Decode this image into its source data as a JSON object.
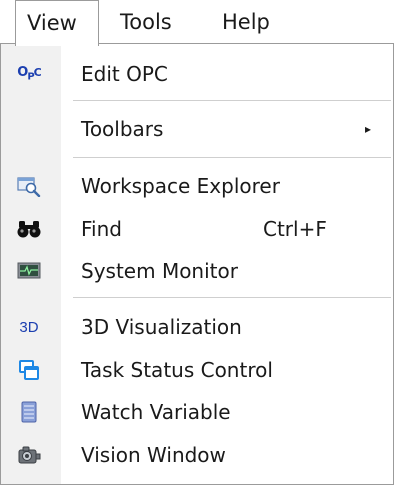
{
  "menubar": {
    "items": [
      {
        "label": "View"
      },
      {
        "label": "Tools"
      },
      {
        "label": "Help"
      }
    ]
  },
  "menu": {
    "items": [
      {
        "label": "Edit OPC",
        "icon": "opc-icon"
      },
      {
        "label": "Toolbars",
        "icon": "none",
        "submenu_arrow": "▸"
      },
      {
        "label": "Workspace Explorer",
        "icon": "workspace-explorer-icon"
      },
      {
        "label": "Find",
        "shortcut": "Ctrl+F",
        "icon": "binoculars-icon"
      },
      {
        "label": "System Monitor",
        "icon": "system-monitor-icon"
      },
      {
        "label": "3D Visualization",
        "icon": "3d-icon",
        "icon_text": "3D"
      },
      {
        "label": "Task Status Control",
        "icon": "task-status-icon"
      },
      {
        "label": "Watch Variable",
        "icon": "watch-variable-icon"
      },
      {
        "label": "Vision Window",
        "icon": "vision-window-icon"
      }
    ]
  },
  "colors": {
    "icon_blue": "#1c3fb0",
    "separator": "#cfcfcf",
    "border": "#9b9b9b"
  }
}
